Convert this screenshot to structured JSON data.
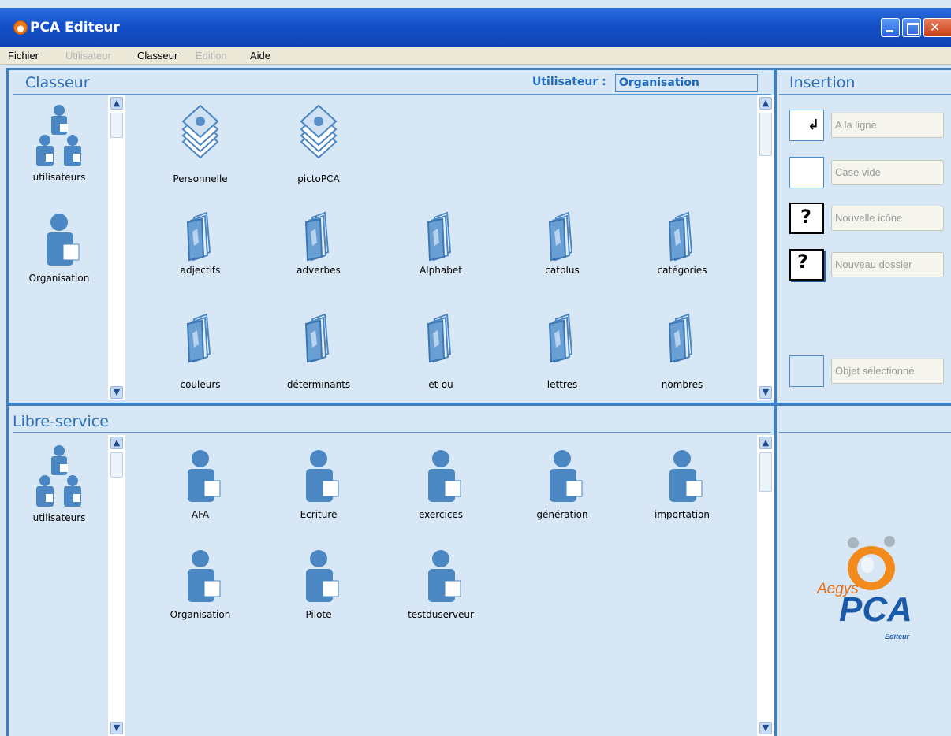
{
  "window": {
    "title": "PCA Editeur"
  },
  "menu": [
    {
      "label": "Fichier",
      "enabled": true
    },
    {
      "label": "Utilisateur",
      "enabled": false
    },
    {
      "label": "Classeur",
      "enabled": true
    },
    {
      "label": "Edition",
      "enabled": false
    },
    {
      "label": "Aide",
      "enabled": true
    }
  ],
  "classeur": {
    "title": "Classeur",
    "user_label": "Utilisateur :",
    "user_value": "Organisation",
    "left_items": [
      "utilisateurs",
      "Organisation"
    ],
    "items_row1": [
      "Personnelle",
      "pictoPCA"
    ],
    "items_row2": [
      "adjectifs",
      "adverbes",
      "Alphabet",
      "catplus",
      "catégories"
    ],
    "items_row3": [
      "couleurs",
      "déterminants",
      "et-ou",
      "lettres",
      "nombres"
    ]
  },
  "insertion": {
    "title": "Insertion",
    "fields": [
      "A la ligne",
      "Case vide",
      "Nouvelle icône",
      "Nouveau dossier",
      "Objet sélectionné"
    ]
  },
  "libre": {
    "title": "Libre-service",
    "left_items": [
      "utilisateurs"
    ],
    "items_row1": [
      "AFA",
      "Ecriture",
      "exercices",
      "génération",
      "importation"
    ],
    "items_row2": [
      "Organisation",
      "Pilote",
      "testduserveur"
    ]
  },
  "logo": {
    "brand": "Aegys",
    "product": "PCA",
    "sub": "Editeur"
  },
  "colors": {
    "accent": "#3d7fc4",
    "panel": "#d8e7f5",
    "title_blue": "#2a6eb8"
  }
}
